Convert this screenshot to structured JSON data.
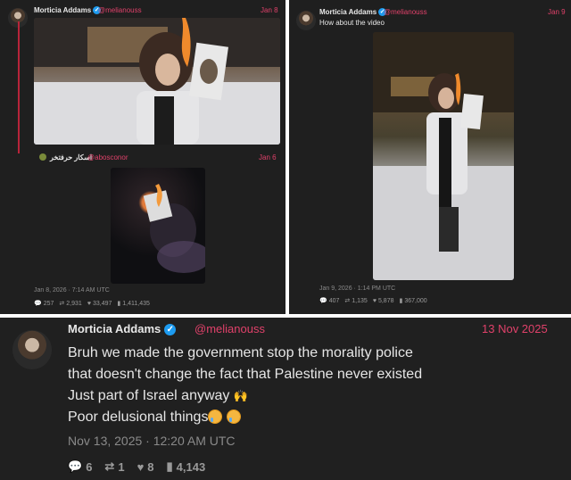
{
  "panel1": {
    "tweet1": {
      "name": "Morticia Addams",
      "verified": "✓",
      "handle": "@melianouss",
      "date": "Jan 8"
    },
    "tweet2": {
      "name": "اسکار حرفتخر",
      "handle": "@abosconor",
      "date": "Jan 6"
    },
    "footer": {
      "meta": "Jan 8, 2026 · 7:14 AM UTC",
      "replies": "257",
      "retweets": "2,931",
      "likes": "33,497",
      "views": "1,411,435"
    }
  },
  "panel2": {
    "tweet": {
      "name": "Morticia Addams",
      "verified": "✓",
      "handle": "@melianouss",
      "date": "Jan 9",
      "text": "How about the video"
    },
    "footer": {
      "meta": "Jan 9, 2026 · 1:14 PM UTC",
      "replies": "407",
      "retweets": "1,135",
      "likes": "5,878",
      "views": "367,000"
    }
  },
  "panel3": {
    "name": "Morticia Addams",
    "verified": "✓",
    "handle": "@melianouss",
    "date": "13 Nov 2025",
    "lines": [
      "Bruh we made the government stop the morality police",
      "that doesn't change the fact that Palestine never existed",
      "Just part of Israel anyway",
      "Poor delusional things"
    ],
    "meta": "Nov 13, 2025 · 12:20 AM UTC",
    "replies": "6",
    "retweets": "1",
    "likes": "8",
    "views": "4,143"
  },
  "icons": {
    "reply": "speech-bubble-icon",
    "retweet": "retweet-icon",
    "like": "heart-icon",
    "views": "bar-chart-icon",
    "verified": "verified-badge-icon"
  },
  "colors": {
    "accent": "#e0416a",
    "verified": "#1d9bf0",
    "background": "#1f1f1f"
  }
}
